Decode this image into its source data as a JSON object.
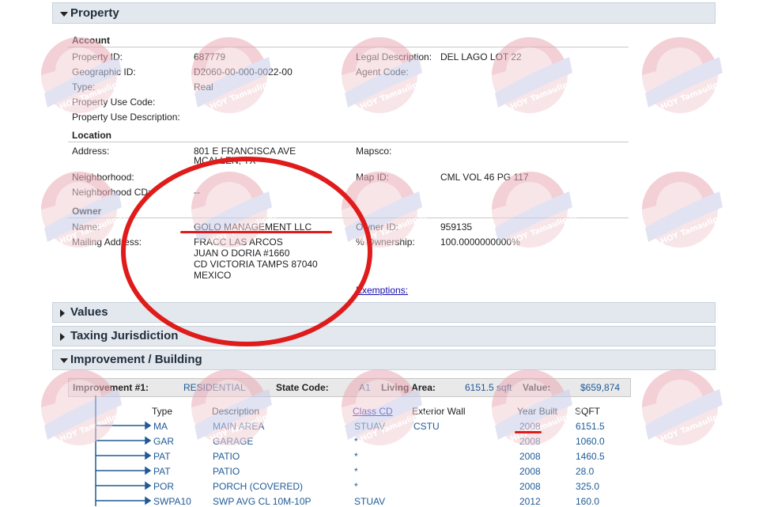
{
  "panels": {
    "property": "Property",
    "values": "Values",
    "taxing": "Taxing Jurisdiction",
    "improvement": "Improvement / Building"
  },
  "account": {
    "heading": "Account",
    "property_id_label": "Property ID:",
    "property_id": "687779",
    "geo_id_label": "Geographic ID:",
    "geo_id": "D2060-00-000-0022-00",
    "type_label": "Type:",
    "type": "Real",
    "use_code_label": "Property Use Code:",
    "use_desc_label": "Property Use Description:",
    "legal_desc_label": "Legal Description:",
    "legal_desc": "DEL LAGO LOT 22",
    "agent_code_label": "Agent Code:"
  },
  "location": {
    "heading": "Location",
    "address_label": "Address:",
    "address_line1": "801 E FRANCISCA AVE",
    "address_line2": "MCALLEN, TX",
    "mapsco_label": "Mapsco:",
    "neighborhood_label": "Neighborhood:",
    "neighborhood_cd_label": "Neighborhood CD:",
    "neighborhood_cd": "--",
    "map_id_label": "Map ID:",
    "map_id": "CML VOL 46 PG 117"
  },
  "owner": {
    "heading": "Owner",
    "name_label": "Name:",
    "name": "GOLO MANAGEMENT LLC",
    "mailing_label": "Mailing Address:",
    "mailing_line1": "FRACC LAS ARCOS",
    "mailing_line2": "JUAN O DORIA #1660",
    "mailing_line3": "CD VICTORIA TAMPS 87040",
    "mailing_line4": "MEXICO",
    "owner_id_label": "Owner ID:",
    "owner_id": "959135",
    "ownership_label": "% Ownership:",
    "ownership": "100.0000000000%",
    "exemptions_link": "Exemptions:"
  },
  "improvement": {
    "num_label": "Improvement #1:",
    "num_value": "RESIDENTIAL",
    "state_code_label": "State Code:",
    "state_code": "A1",
    "living_area_label": "Living Area:",
    "living_area": "6151.5 sqft",
    "value_label": "Value:",
    "value": "$659,874",
    "columns": [
      "Type",
      "Description",
      "Class CD",
      "Exterior Wall",
      "Year Built",
      "SQFT"
    ],
    "rows": [
      {
        "type": "MA",
        "desc": "MAIN AREA",
        "class": "STUAV",
        "wall": "CSTU",
        "year": "2008",
        "sqft": "6151.5"
      },
      {
        "type": "GAR",
        "desc": "GARAGE",
        "class": "*",
        "wall": "",
        "year": "2008",
        "sqft": "1060.0"
      },
      {
        "type": "PAT",
        "desc": "PATIO",
        "class": "*",
        "wall": "",
        "year": "2008",
        "sqft": "1460.5"
      },
      {
        "type": "PAT",
        "desc": "PATIO",
        "class": "*",
        "wall": "",
        "year": "2008",
        "sqft": "28.0"
      },
      {
        "type": "POR",
        "desc": "PORCH (COVERED)",
        "class": "*",
        "wall": "",
        "year": "2008",
        "sqft": "325.0"
      },
      {
        "type": "SWPA10",
        "desc": "SWP AVG CL 10M-10P",
        "class": "STUAV",
        "wall": "",
        "year": "2012",
        "sqft": "160.0"
      }
    ]
  },
  "watermark": {
    "text": "HOY TamaulipasTV"
  },
  "colors": {
    "annotation_red": "#e01b1b",
    "panel_bg": "#e3e8ee",
    "value_blue": "#1f5a96",
    "link_blue": "#1a0dab"
  }
}
